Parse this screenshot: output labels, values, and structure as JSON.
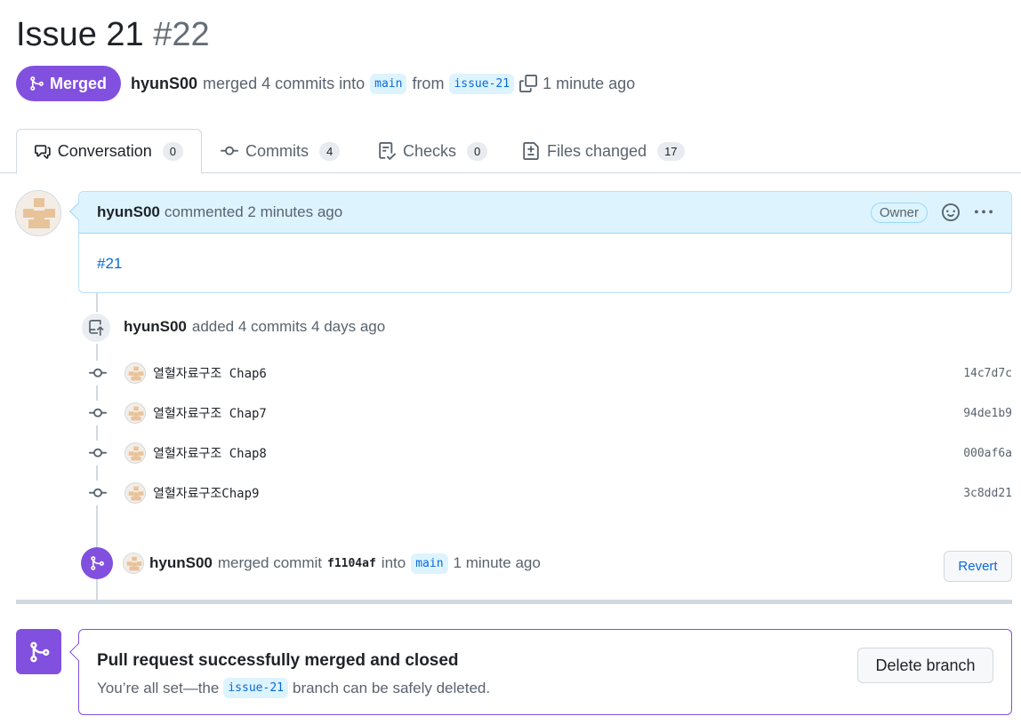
{
  "pr": {
    "title": "Issue 21",
    "number": "#22",
    "state_label": "Merged",
    "author": "hyunS00",
    "summary_merged": "merged 4 commits into",
    "base_branch": "main",
    "from_word": "from",
    "head_branch": "issue-21",
    "time_ago": "1 minute ago"
  },
  "tabs": [
    {
      "label": "Conversation",
      "count": "0"
    },
    {
      "label": "Commits",
      "count": "4"
    },
    {
      "label": "Checks",
      "count": "0"
    },
    {
      "label": "Files changed",
      "count": "17"
    }
  ],
  "comment": {
    "author": "hyunS00",
    "action": "commented 2 minutes ago",
    "role": "Owner",
    "body": "#21"
  },
  "added_event": {
    "author": "hyunS00",
    "text": "added 4 commits 4 days ago"
  },
  "commits": [
    {
      "message": "열혈자료구조 Chap6",
      "sha": "14c7d7c"
    },
    {
      "message": "열혈자료구조 Chap7",
      "sha": "94de1b9"
    },
    {
      "message": "열혈자료구조 Chap8",
      "sha": "000af6a"
    },
    {
      "message": "열혈자료구조Chap9",
      "sha": "3c8dd21"
    }
  ],
  "merge_event": {
    "author": "hyunS00",
    "text": "merged commit",
    "sha": "f1104af",
    "into": "into",
    "branch": "main",
    "time": "1 minute ago",
    "revert_label": "Revert"
  },
  "merge_status": {
    "title": "Pull request successfully merged and closed",
    "desc_prefix": "You’re all set—the",
    "branch": "issue-21",
    "desc_suffix": "branch can be safely deleted.",
    "delete_label": "Delete branch"
  },
  "colors": {
    "merged_purple": "#8250df",
    "link_blue": "#0969da",
    "header_blue": "#ddf4ff"
  }
}
